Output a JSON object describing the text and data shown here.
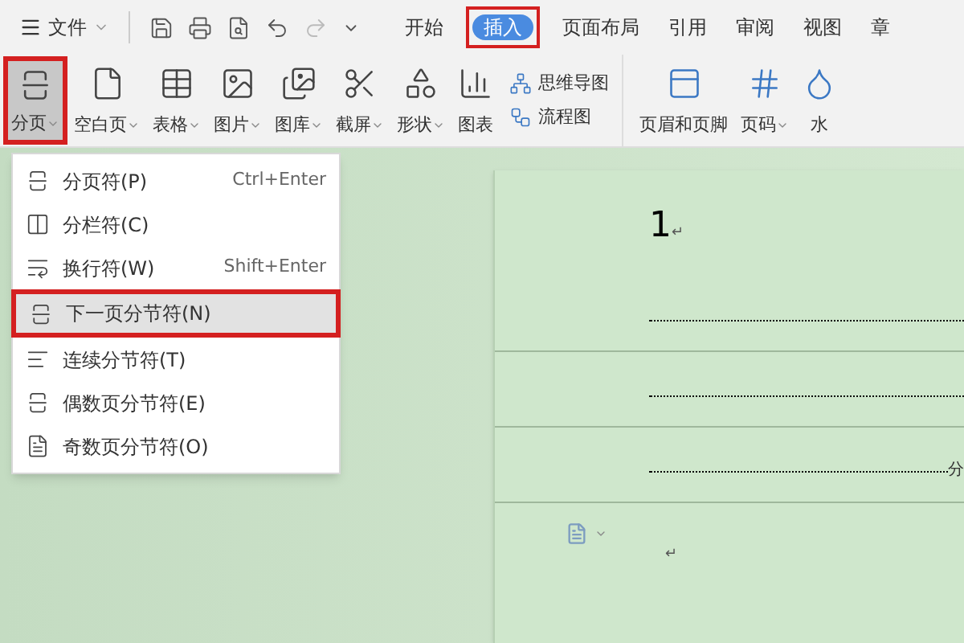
{
  "menu_bar": {
    "file_label": "文件",
    "tabs": [
      {
        "label": "开始",
        "selected": false,
        "annotated": false
      },
      {
        "label": "插入",
        "selected": true,
        "annotated": true
      },
      {
        "label": "页面布局",
        "selected": false,
        "annotated": false
      },
      {
        "label": "引用",
        "selected": false,
        "annotated": false
      },
      {
        "label": "审阅",
        "selected": false,
        "annotated": false
      },
      {
        "label": "视图",
        "selected": false,
        "annotated": false
      },
      {
        "label": "章",
        "selected": false,
        "annotated": false
      }
    ]
  },
  "ribbon": {
    "buttons": [
      {
        "kind": "large",
        "label": "分页",
        "dropdown": true,
        "pressed": true,
        "annotated": true
      },
      {
        "kind": "large",
        "label": "空白页",
        "dropdown": true,
        "pressed": false,
        "annotated": false
      },
      {
        "kind": "large",
        "label": "表格",
        "dropdown": true,
        "pressed": false,
        "annotated": false
      },
      {
        "kind": "large",
        "label": "图片",
        "dropdown": true,
        "pressed": false,
        "annotated": false
      },
      {
        "kind": "large",
        "label": "图库",
        "dropdown": true,
        "pressed": false,
        "annotated": false
      },
      {
        "kind": "large",
        "label": "截屏",
        "dropdown": true,
        "pressed": false,
        "annotated": false
      },
      {
        "kind": "large",
        "label": "形状",
        "dropdown": true,
        "pressed": false,
        "annotated": false
      },
      {
        "kind": "large",
        "label": "图表",
        "dropdown": false,
        "pressed": false,
        "annotated": false
      },
      {
        "kind": "small",
        "items": [
          {
            "label": "思维导图"
          },
          {
            "label": "流程图"
          }
        ]
      },
      {
        "kind": "large",
        "label": "页眉和页脚",
        "dropdown": false,
        "pressed": false,
        "annotated": false
      },
      {
        "kind": "large",
        "label": "页码",
        "dropdown": true,
        "pressed": false,
        "annotated": false
      },
      {
        "kind": "large",
        "label": "水",
        "dropdown": false,
        "pressed": false,
        "annotated": false
      }
    ]
  },
  "dropdown_menu": {
    "items": [
      {
        "label": "分页符(P)",
        "shortcut": "Ctrl+Enter",
        "selected": false,
        "annotated": false
      },
      {
        "label": "分栏符(C)",
        "selected": false,
        "annotated": false
      },
      {
        "label": "换行符(W)",
        "shortcut": "Shift+Enter",
        "selected": false,
        "annotated": false
      },
      {
        "label": "下一页分节符(N)",
        "selected": true,
        "annotated": true
      },
      {
        "label": "连续分节符(T)",
        "selected": false,
        "annotated": false
      },
      {
        "label": "偶数页分节符(E)",
        "selected": false,
        "annotated": false
      },
      {
        "label": "奇数页分节符(O)",
        "selected": false,
        "annotated": false
      }
    ]
  },
  "document": {
    "heading": "1",
    "heading_mark": "↵",
    "breaks": [
      {
        "kind": "plain"
      },
      {
        "kind": "plain"
      },
      {
        "kind": "labeled",
        "label": "分"
      }
    ],
    "end_mark": "↵"
  }
}
